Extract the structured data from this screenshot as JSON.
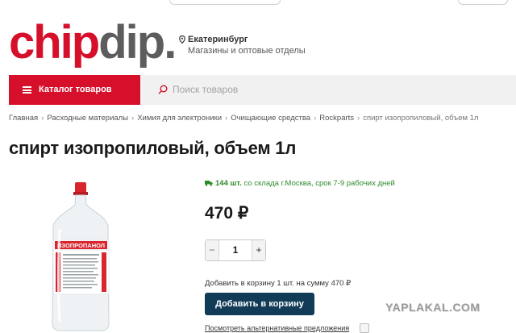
{
  "header": {
    "logo": {
      "part1": "chip",
      "part2": "dip."
    },
    "city": "Екатеринбург",
    "stores_link": "Магазины и оптовые отделы"
  },
  "nav": {
    "catalog_label": "Каталог товаров",
    "search_placeholder": "Поиск товаров"
  },
  "breadcrumb": [
    "Главная",
    "Расходные материалы",
    "Химия для электроники",
    "Очищающие средства",
    "Rockparts",
    "спирт изопропиловый, объем 1л"
  ],
  "product": {
    "title": "спирт изопропиловый, объем 1л",
    "stock_count": "144 шт.",
    "stock_text": "со склада г.Москва, срок 7-9 рабочих дней",
    "price": "470 ₽",
    "quantity": "1",
    "qty_minus": "−",
    "qty_plus": "+",
    "cart_note": "Добавить в корзину 1 шт. на сумму 470 ₽",
    "add_button": "Добавить в корзину",
    "alternatives": "Посмотреть альтернативные предложения"
  },
  "bottle_label": "ИЗОПРОПАНОЛ",
  "watermark": "YAPLAKAL.COM",
  "colors": {
    "brand_red": "#d6102b",
    "logo_gray": "#5d5d5d",
    "button_navy": "#113b57",
    "stock_green": "#2e8b2e"
  }
}
